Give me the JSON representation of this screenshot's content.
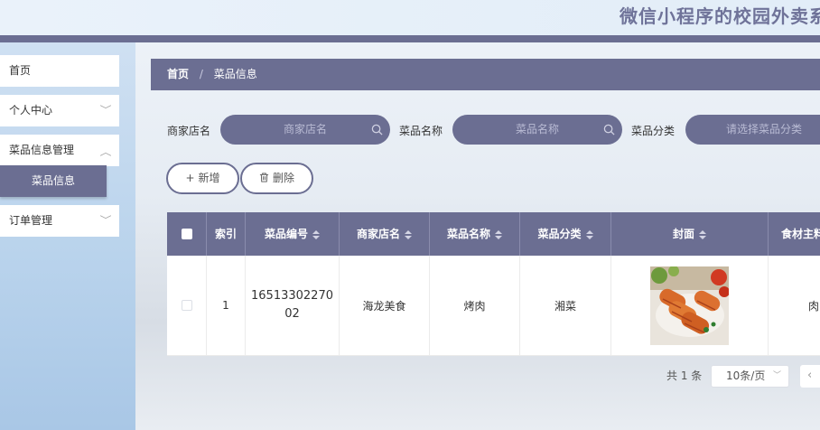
{
  "header": {
    "title": "微信小程序的校园外卖系统"
  },
  "sidebar": {
    "items": [
      {
        "label": "首页"
      },
      {
        "label": "个人中心"
      },
      {
        "label": "菜品信息管理"
      },
      {
        "label": "菜品信息"
      },
      {
        "label": "订单管理"
      }
    ],
    "chevron": "﹀"
  },
  "breadcrumb": {
    "home": "首页",
    "separator": "/",
    "current": "菜品信息"
  },
  "filters": {
    "shop_label": "商家店名",
    "shop_placeholder": "商家店名",
    "dish_label": "菜品名称",
    "dish_placeholder": "菜品名称",
    "category_label": "菜品分类",
    "category_placeholder": "请选择菜品分类"
  },
  "actions": {
    "add_label": "新增",
    "add_icon": "+",
    "delete_label": "删除"
  },
  "table": {
    "columns": [
      "索引",
      "菜品编号",
      "商家店名",
      "菜品名称",
      "菜品分类",
      "封面",
      "食材主料"
    ],
    "rows": [
      {
        "index": "1",
        "code": "1651330227002",
        "code_line1": "16513302270",
        "code_line2": "02",
        "shop": "海龙美食",
        "dish": "烤肉",
        "category": "湘菜",
        "ingredient": "肉"
      }
    ]
  },
  "pagination": {
    "total": "共 1 条",
    "page_size": "10条/页",
    "chevron": "﹀",
    "prev": "‹"
  },
  "colors": {
    "accent": "#6b6e92",
    "sidebar_bg": "#b9d3ec",
    "title": "#6f7399"
  }
}
